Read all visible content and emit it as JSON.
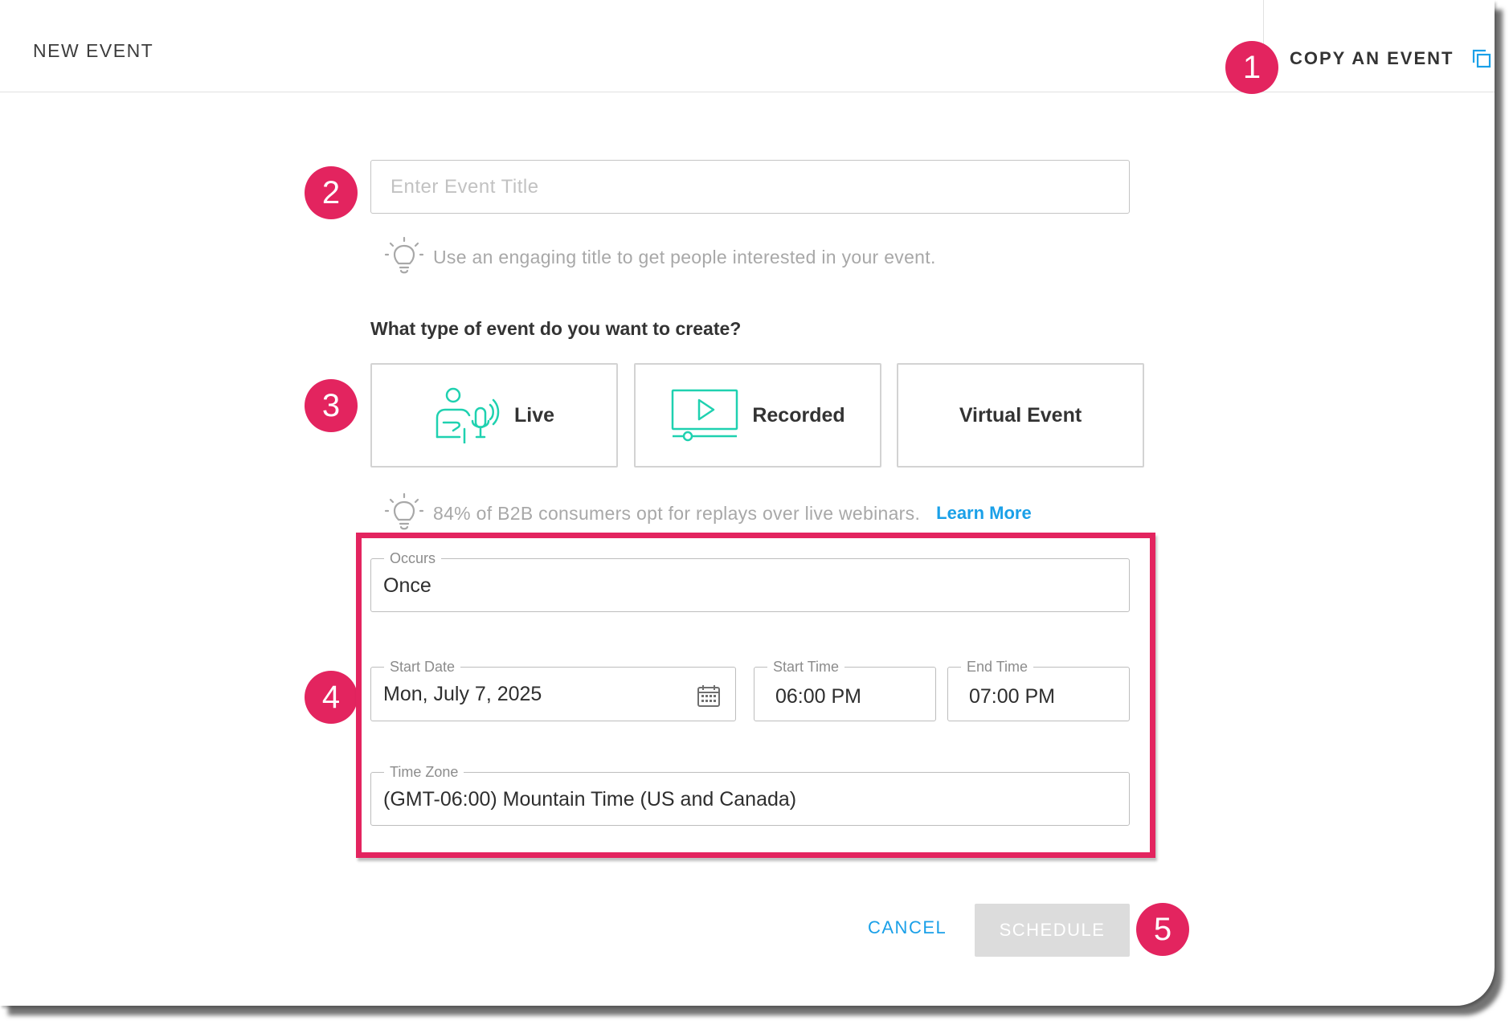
{
  "header": {
    "title": "NEW EVENT",
    "copy_event_label": "COPY AN EVENT"
  },
  "badges": [
    "1",
    "2",
    "3",
    "4",
    "5"
  ],
  "form": {
    "title_placeholder": "Enter Event Title",
    "title_value": "",
    "title_tip": "Use an engaging title to get people interested in your event.",
    "event_type_question": "What type of event do you want to create?",
    "event_types": [
      {
        "label": "Live",
        "icon": "live-presenter-icon"
      },
      {
        "label": "Recorded",
        "icon": "recorded-video-icon"
      },
      {
        "label": "Virtual Event",
        "icon": ""
      }
    ],
    "replay_tip": "84% of B2B consumers opt for replays over live webinars.",
    "learn_more": "Learn More",
    "occurs": {
      "label": "Occurs",
      "value": "Once"
    },
    "start_date": {
      "label": "Start Date",
      "value": "Mon, July 7, 2025"
    },
    "start_time": {
      "label": "Start Time",
      "value": "06:00 PM"
    },
    "end_time": {
      "label": "End Time",
      "value": "07:00 PM"
    },
    "time_zone": {
      "label": "Time Zone",
      "value": "(GMT-06:00) Mountain Time (US and Canada)"
    }
  },
  "actions": {
    "cancel": "CANCEL",
    "schedule": "SCHEDULE"
  },
  "colors": {
    "accent": "#1aa0e8",
    "badge": "#e3245f",
    "icon_teal": "#1fd1b0",
    "disabled_button": "#dcdcdc"
  }
}
